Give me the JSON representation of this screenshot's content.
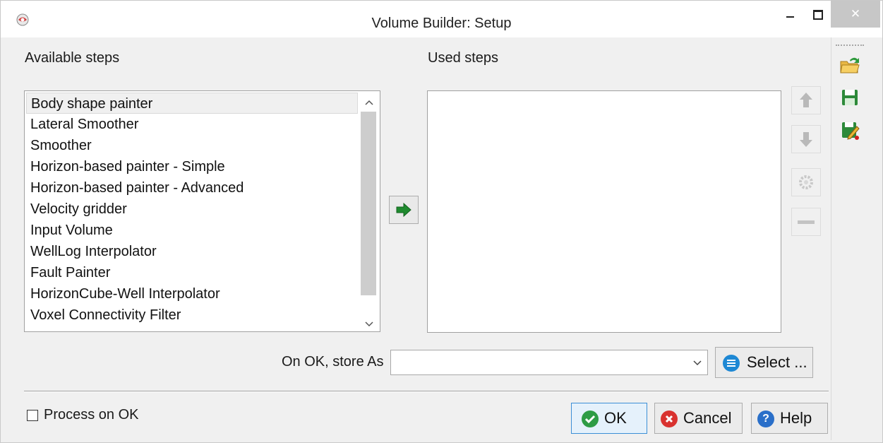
{
  "window": {
    "title": "Volume Builder: Setup",
    "minimize_label": "–",
    "close_label": "✕"
  },
  "available": {
    "label": "Available steps",
    "items": [
      "Body shape painter",
      "Lateral Smoother",
      "Smoother",
      "Horizon-based painter - Simple",
      "Horizon-based painter - Advanced",
      "Velocity gridder",
      "Input Volume",
      "WellLog Interpolator",
      "Fault Painter",
      "HorizonCube-Well Interpolator",
      "Voxel Connectivity Filter"
    ],
    "selected_index": 0,
    "scroll_up": "^",
    "scroll_down": "v"
  },
  "used": {
    "label": "Used steps",
    "items": []
  },
  "store": {
    "label": "On OK, store As",
    "value": "",
    "select_label": "Select ..."
  },
  "footer": {
    "process_on_ok_label": "Process on OK",
    "process_on_ok_checked": false,
    "ok_label": "OK",
    "cancel_label": "Cancel",
    "help_label": "Help"
  },
  "colors": {
    "accent_green": "#2e8b3a",
    "cancel_red": "#d9322f",
    "help_blue": "#2a6fc9",
    "select_blue": "#1e88d4"
  }
}
